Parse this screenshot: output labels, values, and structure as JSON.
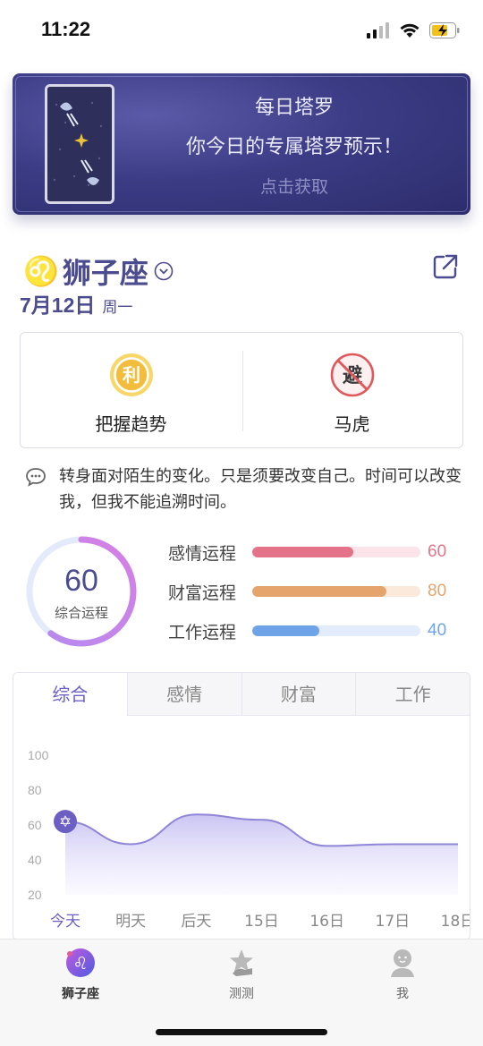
{
  "status_bar": {
    "time": "11:22",
    "icons": [
      "signal-icon",
      "wifi-icon",
      "battery-charging-icon"
    ]
  },
  "banner": {
    "title": "每日塔罗",
    "subtitle": "你今日的专属塔罗预示！",
    "cta": "点击获取"
  },
  "sign": {
    "name": "狮子座",
    "symbol": "♌",
    "date": "7月12日",
    "weekday": "周一"
  },
  "advice": {
    "good": {
      "badge": "利",
      "label": "把握趋势",
      "color": "#f2bd3c"
    },
    "avoid": {
      "badge": "避",
      "label": "马虎",
      "color": "#e0585c"
    }
  },
  "quote": "转身面对陌生的变化。只是须要改变自己。时间可以改变我，但我不能追溯时间。",
  "overall": {
    "score": "60",
    "label": "综合运程",
    "fraction": 0.6
  },
  "scores": [
    {
      "label": "感情运程",
      "value": "60",
      "fill": 0.6,
      "color": "#e4738a",
      "track": "#fbe3ea"
    },
    {
      "label": "财富运程",
      "value": "80",
      "fill": 0.8,
      "color": "#e5a46c",
      "track": "#fbeadb"
    },
    {
      "label": "工作运程",
      "value": "40",
      "fill": 0.4,
      "color": "#6fa3e8",
      "track": "#e3ecfa"
    }
  ],
  "tabs": [
    {
      "label": "综合",
      "active": true
    },
    {
      "label": "感情",
      "active": false
    },
    {
      "label": "财富",
      "active": false
    },
    {
      "label": "工作",
      "active": false
    }
  ],
  "chart_data": {
    "type": "area",
    "categories": [
      "今天",
      "明天",
      "后天",
      "15日",
      "16日",
      "17日",
      "18日"
    ],
    "values": [
      62,
      49,
      66,
      63,
      48,
      49,
      49
    ],
    "ylim": [
      20,
      100
    ],
    "yticks": [
      100,
      80,
      60,
      40,
      20
    ],
    "color": "#8f86d8",
    "grid": false
  },
  "nav": [
    {
      "label": "狮子座",
      "icon": "leo-icon",
      "active": true
    },
    {
      "label": "测测",
      "icon": "star-hand-icon",
      "active": false
    },
    {
      "label": "我",
      "icon": "user-icon",
      "active": false
    }
  ]
}
